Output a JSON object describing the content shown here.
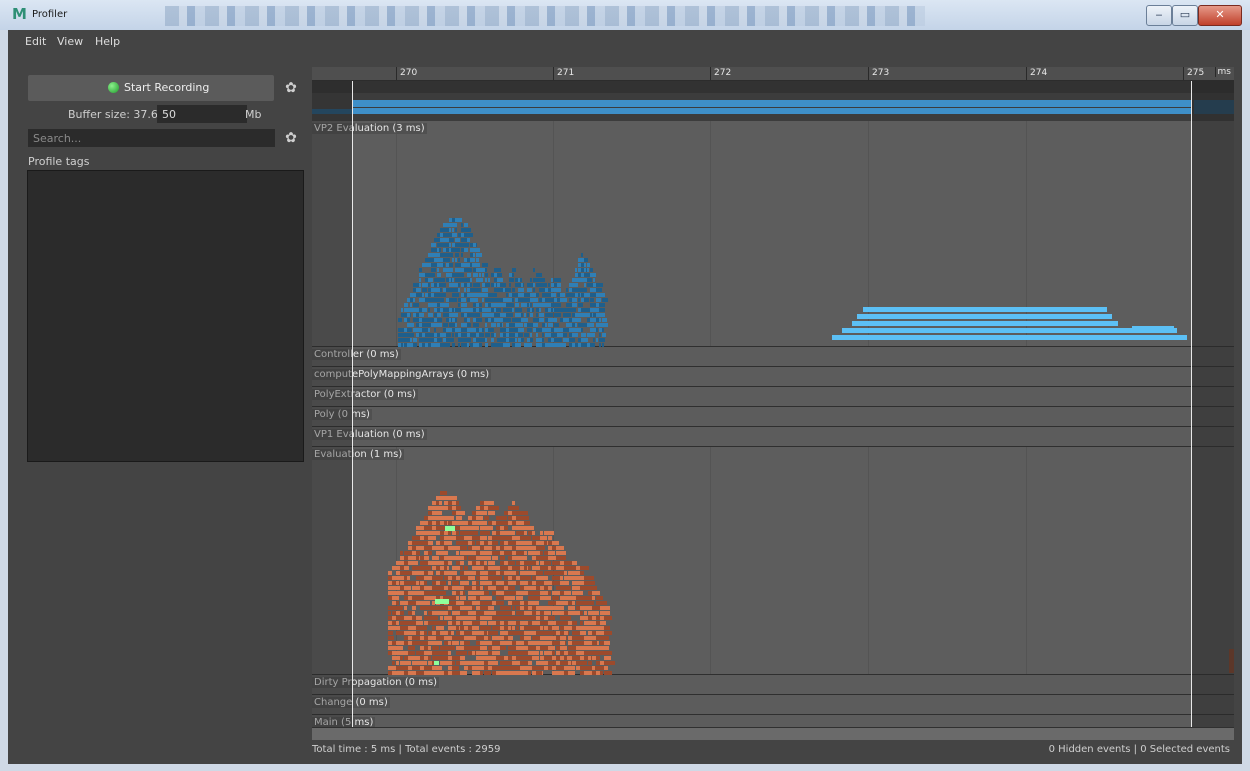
{
  "window": {
    "title": "Profiler",
    "logo": "M",
    "minimize": "‒",
    "maximize": "▭",
    "close": "✕"
  },
  "menu": [
    "Edit",
    "View",
    "Help"
  ],
  "sidebar": {
    "record_label": "Start Recording",
    "buffer_label": "Buffer size: 37.6 /",
    "buffer_value": "50",
    "buffer_unit": "Mb",
    "search_placeholder": "Search...",
    "profile_tags_label": "Profile tags",
    "gear_glyph": "✿"
  },
  "ruler": {
    "ticks": [
      "270",
      "271",
      "272",
      "273",
      "274",
      "275"
    ],
    "unit": "ms"
  },
  "categories": [
    "VP2 Evaluation (3 ms)",
    "Controller (0 ms)",
    "computePolyMappingArrays (0 ms)",
    "PolyExtractor (0 ms)",
    "Poly (0 ms)",
    "VP1 Evaluation (0 ms)",
    "Evaluation (1 ms)",
    "Dirty Propagation (0 ms)",
    "Change (0 ms)",
    "Main (5 ms)"
  ],
  "status": {
    "left": "Total time : 5 ms | Total events : 2959",
    "right": "0 Hidden events | 0 Selected events"
  },
  "colors": {
    "vp2_event": "#2f7fb6",
    "vp2_event_dark": "#1e5f8c",
    "vp2_long": "#5cc0f5",
    "eval_event": "#d9784f",
    "eval_event_dark": "#9c4a2c",
    "highlight": "#8fff9b",
    "main_pink": "#f4a483",
    "main_green": "#6cc36a",
    "main_yellow": "#d7d56a",
    "main_navy": "#224d73"
  }
}
